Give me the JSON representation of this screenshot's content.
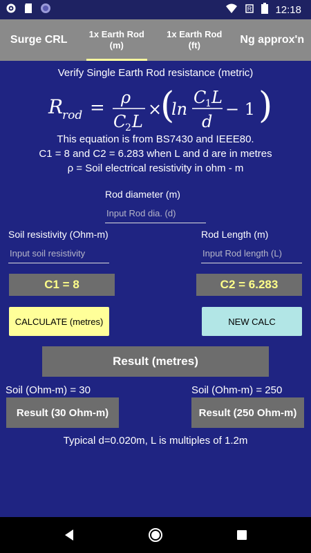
{
  "status": {
    "time": "12:18"
  },
  "tabs": [
    {
      "label": "Surge CRL",
      "active": false
    },
    {
      "label": "1x Earth Rod\n(m)",
      "active": true
    },
    {
      "label": "1x Earth Rod\n(ft)",
      "active": false
    },
    {
      "label": "Ng approx'n",
      "active": false
    }
  ],
  "heading": "Verify Single Earth Rod resistance (metric)",
  "formula": {
    "lhs": "R",
    "lhs_sub": "rod",
    "num1": "ρ",
    "den1": "C",
    "den1_sub": "2",
    "den1_tail": "L",
    "times": "×",
    "ln": "ln",
    "num2": "C",
    "num2_sub": "1",
    "num2_tail": "L",
    "den2": "d",
    "minus_one": "− 1"
  },
  "info": {
    "line1": "This equation is from BS7430 and IEEE80.",
    "line2": "C1 = 8 and C2 = 6.283 when L and d are in metres",
    "line3": "ρ = Soil electrical resistivity in ohm - m"
  },
  "inputs": {
    "rod_diameter_label": "Rod diameter (m)",
    "rod_diameter_placeholder": "Input Rod dia. (d)",
    "soil_label": "Soil resistivity (Ohm-m)",
    "soil_placeholder": "Input soil resistivity",
    "length_label": "Rod Length (m)",
    "length_placeholder": "Input Rod length (L)"
  },
  "constants": {
    "c1": "C1 = 8",
    "c2": "C2 = 6.283"
  },
  "buttons": {
    "calculate": "CALCULATE (metres)",
    "new_calc": "NEW CALC",
    "result": "Result (metres)",
    "result30": "Result (30 Ohm-m)",
    "result250": "Result (250 Ohm-m)"
  },
  "soil_labels": {
    "s30": "Soil (Ohm-m) = 30",
    "s250": "Soil (Ohm-m) = 250"
  },
  "footer_note": "Typical d=0.020m, L is multiples of 1.2m",
  "colors": {
    "background": "#1f2482",
    "tabbar": "#8a8a8a",
    "accent_yellow": "#ffff9e",
    "new_calc": "#b2e6e6",
    "gray": "#6d6d6d"
  }
}
